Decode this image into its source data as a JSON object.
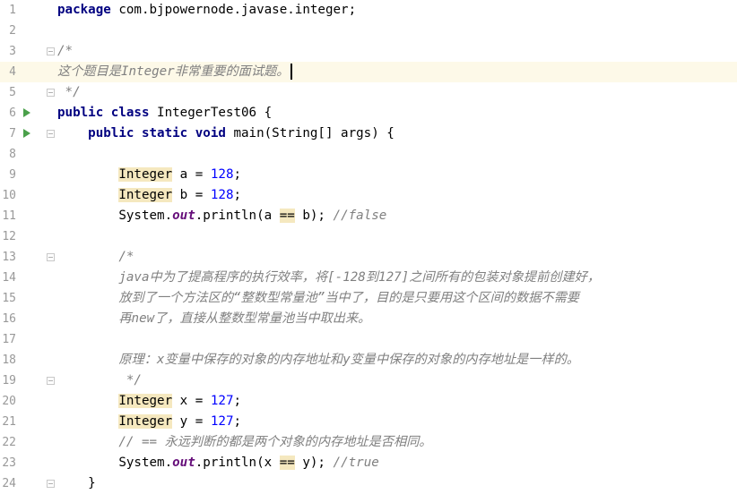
{
  "editor": {
    "lines": [
      {
        "num": "1",
        "run": false,
        "fold": false,
        "segments": [
          {
            "t": "package",
            "c": "kw"
          },
          {
            "t": " com.bjpowernode.javase.integer;"
          }
        ]
      },
      {
        "num": "2",
        "run": false,
        "fold": false,
        "segments": []
      },
      {
        "num": "3",
        "run": false,
        "fold": true,
        "segments": [
          {
            "t": "/*",
            "c": "cm"
          }
        ]
      },
      {
        "num": "4",
        "run": false,
        "fold": false,
        "current": true,
        "caret": true,
        "segments": [
          {
            "t": "这个题目是Integer非常重要的面试题。",
            "c": "cm"
          }
        ]
      },
      {
        "num": "5",
        "run": false,
        "fold": true,
        "segments": [
          {
            "t": " */",
            "c": "cm"
          }
        ]
      },
      {
        "num": "6",
        "run": true,
        "fold": false,
        "segments": [
          {
            "t": "public class",
            "c": "kw"
          },
          {
            "t": " IntegerTest06 {"
          }
        ]
      },
      {
        "num": "7",
        "run": true,
        "fold": true,
        "segments": [
          {
            "t": "    "
          },
          {
            "t": "public static void",
            "c": "kw"
          },
          {
            "t": " main(String[] args) {"
          }
        ]
      },
      {
        "num": "8",
        "run": false,
        "fold": false,
        "segments": []
      },
      {
        "num": "9",
        "run": false,
        "fold": false,
        "segments": [
          {
            "t": "        "
          },
          {
            "t": "Integer",
            "c": "hl"
          },
          {
            "t": " a = "
          },
          {
            "t": "128",
            "c": "num"
          },
          {
            "t": ";"
          }
        ]
      },
      {
        "num": "10",
        "run": false,
        "fold": false,
        "segments": [
          {
            "t": "        "
          },
          {
            "t": "Integer",
            "c": "hl"
          },
          {
            "t": " b = "
          },
          {
            "t": "128",
            "c": "num"
          },
          {
            "t": ";"
          }
        ]
      },
      {
        "num": "11",
        "run": false,
        "fold": false,
        "segments": [
          {
            "t": "        System."
          },
          {
            "t": "out",
            "c": "static"
          },
          {
            "t": ".println(a "
          },
          {
            "t": "==",
            "c": "hl"
          },
          {
            "t": " b); "
          },
          {
            "t": "//false",
            "c": "cm"
          }
        ]
      },
      {
        "num": "12",
        "run": false,
        "fold": false,
        "segments": []
      },
      {
        "num": "13",
        "run": false,
        "fold": true,
        "segments": [
          {
            "t": "        "
          },
          {
            "t": "/*",
            "c": "cm"
          }
        ]
      },
      {
        "num": "14",
        "run": false,
        "fold": false,
        "segments": [
          {
            "t": "        "
          },
          {
            "t": "java中为了提高程序的执行效率，将[-128到127]之间所有的包装对象提前创建好，",
            "c": "cm"
          }
        ]
      },
      {
        "num": "15",
        "run": false,
        "fold": false,
        "segments": [
          {
            "t": "        "
          },
          {
            "t": "放到了一个方法区的“整数型常量池”当中了，目的是只要用这个区间的数据不需要",
            "c": "cm"
          }
        ]
      },
      {
        "num": "16",
        "run": false,
        "fold": false,
        "segments": [
          {
            "t": "        "
          },
          {
            "t": "再new了，直接从整数型常量池当中取出来。",
            "c": "cm"
          }
        ]
      },
      {
        "num": "17",
        "run": false,
        "fold": false,
        "segments": []
      },
      {
        "num": "18",
        "run": false,
        "fold": false,
        "segments": [
          {
            "t": "        "
          },
          {
            "t": "原理：x变量中保存的对象的内存地址和y变量中保存的对象的内存地址是一样的。",
            "c": "cm"
          }
        ]
      },
      {
        "num": "19",
        "run": false,
        "fold": true,
        "segments": [
          {
            "t": "         "
          },
          {
            "t": "*/",
            "c": "cm"
          }
        ]
      },
      {
        "num": "20",
        "run": false,
        "fold": false,
        "segments": [
          {
            "t": "        "
          },
          {
            "t": "Integer",
            "c": "hl"
          },
          {
            "t": " x = "
          },
          {
            "t": "127",
            "c": "num"
          },
          {
            "t": ";"
          }
        ]
      },
      {
        "num": "21",
        "run": false,
        "fold": false,
        "segments": [
          {
            "t": "        "
          },
          {
            "t": "Integer",
            "c": "hl"
          },
          {
            "t": " y = "
          },
          {
            "t": "127",
            "c": "num"
          },
          {
            "t": ";"
          }
        ]
      },
      {
        "num": "22",
        "run": false,
        "fold": false,
        "segments": [
          {
            "t": "        "
          },
          {
            "t": "// == 永远判断的都是两个对象的内存地址是否相同。",
            "c": "cm"
          }
        ]
      },
      {
        "num": "23",
        "run": false,
        "fold": false,
        "segments": [
          {
            "t": "        System."
          },
          {
            "t": "out",
            "c": "static"
          },
          {
            "t": ".println(x "
          },
          {
            "t": "==",
            "c": "hl"
          },
          {
            "t": " y); "
          },
          {
            "t": "//true",
            "c": "cm"
          }
        ]
      },
      {
        "num": "24",
        "run": false,
        "fold": true,
        "segments": [
          {
            "t": "    }"
          }
        ]
      }
    ]
  },
  "colors": {
    "keyword": "#000080",
    "number": "#0000ff",
    "comment": "#808080",
    "static_field": "#660e7a",
    "highlight": "#f5e8bf",
    "current_line": "#fdf9e8",
    "run_icon": "#4aa04a"
  }
}
